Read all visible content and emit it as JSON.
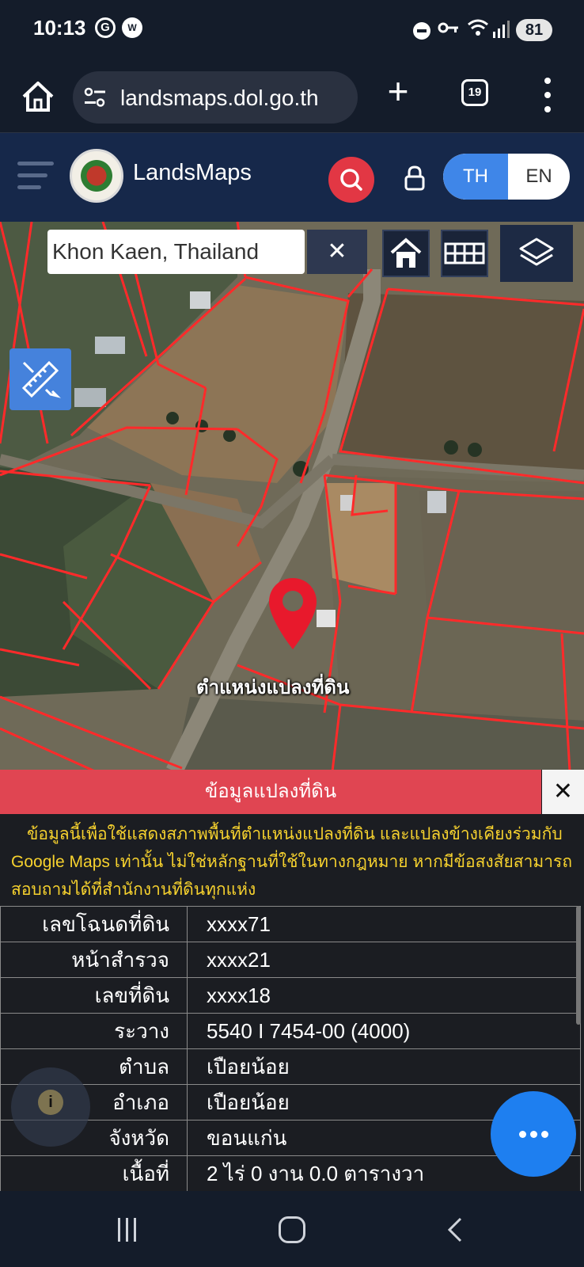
{
  "status_bar": {
    "time": "10:13",
    "app_icon_1": "G",
    "app_icon_2": "W",
    "battery": "81",
    "icons": [
      "dnd-icon",
      "vpn-key-icon",
      "wifi-icon",
      "signal-icon",
      "battery-icon"
    ]
  },
  "browser": {
    "url": "landsmaps.dol.go.th",
    "tab_count": "19"
  },
  "app": {
    "brand": "LandsMaps",
    "lang_th": "TH",
    "lang_en": "EN"
  },
  "map": {
    "search_value": "Khon Kaen, Thailand",
    "clear_label": "✕",
    "pin_label": "ตำแหน่งแปลงที่ดิน",
    "colors": {
      "parcel_line": "#ff2a2a",
      "pin": "#e8192c"
    }
  },
  "panel": {
    "title": "ข้อมูลแปลงที่ดิน",
    "close_label": "✕",
    "notice": "ข้อมูลนี้เพื่อใช้แสดงสภาพพื้นที่ตำแหน่งแปลงที่ดิน และแปลงข้างเคียงร่วมกับ Google Maps เท่านั้น ไม่ใช่หลักฐานที่ใช้ในทางกฎหมาย หากมีข้อสงสัยสามารถสอบถามได้ที่สำนักงานที่ดินทุกแห่ง",
    "rows": [
      {
        "label": "เลขโฉนดที่ดิน",
        "value": "xxxx71"
      },
      {
        "label": "หน้าสำรวจ",
        "value": "xxxx21"
      },
      {
        "label": "เลขที่ดิน",
        "value": "xxxx18"
      },
      {
        "label": "ระวาง",
        "value": "5540 I 7454-00 (4000)"
      },
      {
        "label": "ตำบล",
        "value": "เปือยน้อย"
      },
      {
        "label": "อำเภอ",
        "value": "เปือยน้อย"
      },
      {
        "label": "จังหวัด",
        "value": "ขอนแก่น"
      },
      {
        "label": "เนื้อที่",
        "value": "2 ไร่ 0 งาน 0.0 ตารางวา"
      }
    ],
    "info_label": "i"
  }
}
